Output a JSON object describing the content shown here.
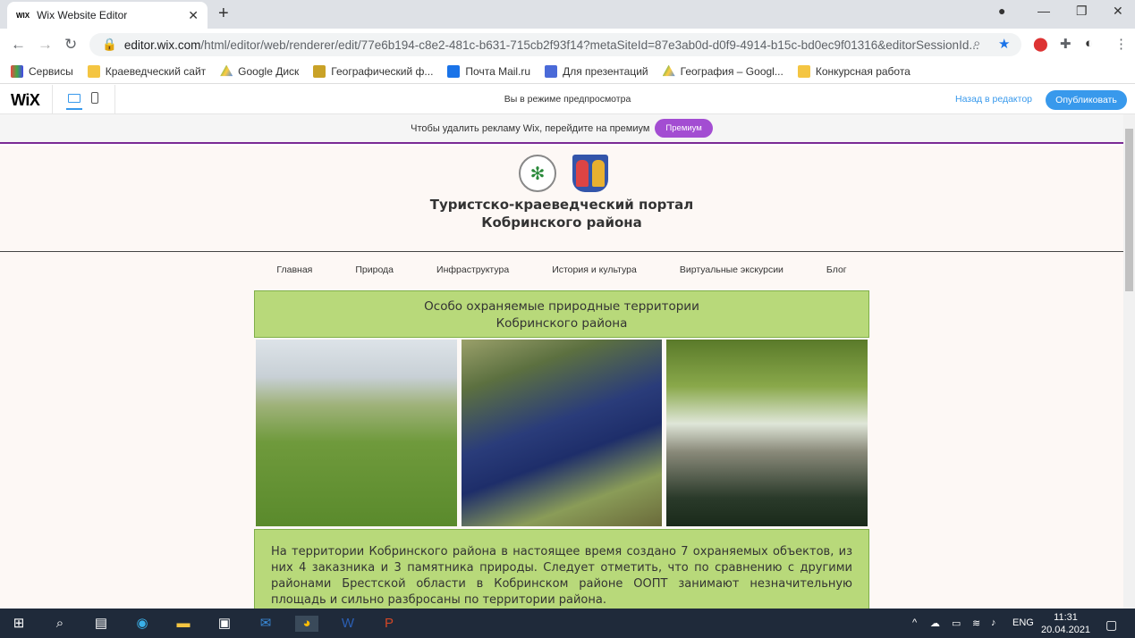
{
  "browser": {
    "tab_favicon": "WIX",
    "tab_title": "Wix Website Editor",
    "url_domain": "editor.wix.com",
    "url_path": "/html/editor/web/renderer/edit/77e6b194-c8e2-481c-b631-715cb2f93f14?metaSiteId=87e3ab0d-d0f9-4914-b15c-bd0ec9f01316&editorSessionId...",
    "bookmarks": [
      "Сервисы",
      "Краеведческий сайт",
      "Google Диск",
      "Географический ф...",
      "Почта Mail.ru",
      "Для презентаций",
      "География – Googl...",
      "Конкурсная работа"
    ]
  },
  "wix": {
    "logo": "WiX",
    "preview_text": "Вы в режиме предпросмотра",
    "back_label": "Назад в редактор",
    "publish_label": "Опубликовать",
    "ad_text": "Чтобы удалить рекламу Wix, перейдите на премиум",
    "premium_label": "Премиум"
  },
  "site": {
    "title_line1": "Туристско-краеведческий портал",
    "title_line2": "Кобринского района",
    "menu": [
      "Главная",
      "Природа",
      "Инфраструктура",
      "История и культура",
      "Виртуальные экскурсии",
      "Блог"
    ],
    "section_line1": "Особо охраняемые природные территории",
    "section_line2": "Кобринского района",
    "body_text": "На территории Кобринского района в настоящее время создано 7 охраняемых объектов, из них 4 заказника и 3 памятника природы. Следует отметить, что по сравнению с другими районами Брестской области в Кобринском районе ООПТ занимают незначительную площадь и сильно разбросаны по территории района."
  },
  "taskbar": {
    "lang": "ENG",
    "time": "11:31",
    "date": "20.04.2021"
  },
  "colors": {
    "wix_blue": "#3899ec",
    "premium_purple": "#a34dd2",
    "section_green": "#b8d97a"
  }
}
